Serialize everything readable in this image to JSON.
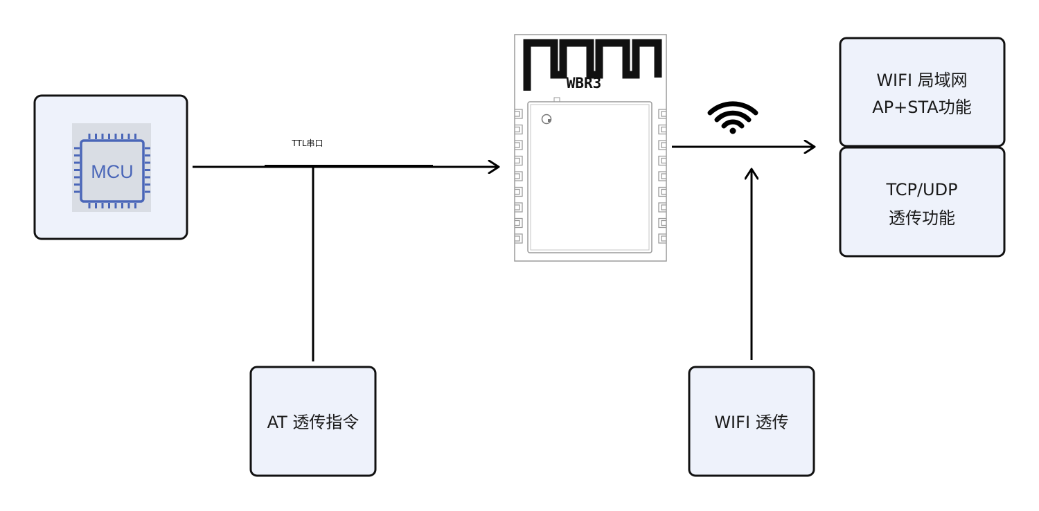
{
  "colors": {
    "box_fill": "#eef2fb",
    "box_stroke": "#111111",
    "line": "#000000",
    "chip_bg": "#d9dde4",
    "chip_blue": "#4a66b8",
    "module_stroke": "#9a9a9a",
    "antenna": "#111111"
  },
  "mcu": {
    "label": "MCU"
  },
  "serial_link": {
    "label": "TTL串口"
  },
  "at_box": {
    "label": "AT 透传指令"
  },
  "module": {
    "name": "WBR3"
  },
  "wifi_box": {
    "label": "WIFI 透传"
  },
  "lan_box": {
    "line1": "WIFI 局域网",
    "line2": "AP+STA功能"
  },
  "tcp_box": {
    "line1": "TCP/UDP",
    "line2": "透传功能"
  },
  "icons": {
    "wifi": "wifi-signal-icon",
    "chip": "microchip-icon"
  }
}
